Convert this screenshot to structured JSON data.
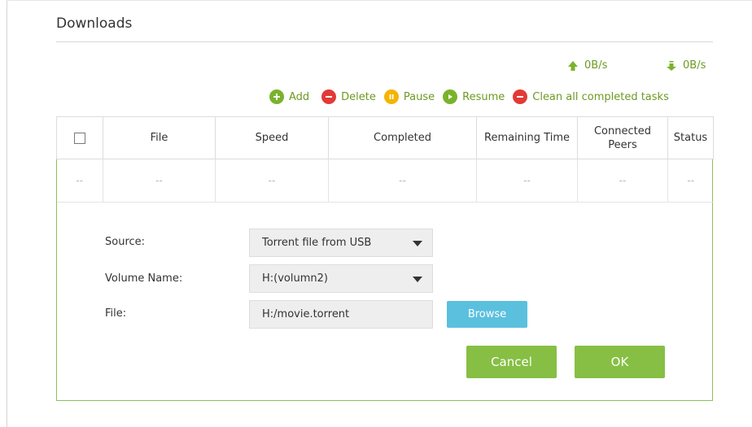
{
  "section": {
    "title": "Downloads"
  },
  "rates": {
    "upload": "0B/s",
    "download": "0B/s"
  },
  "actions": {
    "add": "Add",
    "delete": "Delete",
    "pause": "Pause",
    "resume": "Resume",
    "clean": "Clean all completed tasks"
  },
  "table": {
    "headers": {
      "file": "File",
      "speed": "Speed",
      "completed": "Completed",
      "remaining": "Remaining Time",
      "peers": "Connected Peers",
      "status": "Status"
    },
    "empty_row": [
      "--",
      "--",
      "--",
      "--",
      "--",
      "--",
      "--"
    ]
  },
  "form": {
    "source": {
      "label": "Source:",
      "value": "Torrent file from USB"
    },
    "volume": {
      "label": "Volume Name:",
      "value": "H:(volumn2)"
    },
    "file": {
      "label": "File:",
      "value": "H:/movie.torrent"
    },
    "browse_label": "Browse",
    "cancel_label": "Cancel",
    "ok_label": "OK"
  },
  "colors": {
    "accent_green": "#7ab32b",
    "text_green": "#6e9a22",
    "danger_red": "#e23a36",
    "pause_yellow": "#f4b400",
    "browse_blue": "#5bc0de",
    "panel_border": "#8dc05a"
  },
  "icons": {
    "upload": "arrow-up-icon",
    "download": "arrow-down-icon",
    "add": "plus-circle-icon",
    "delete": "minus-circle-icon",
    "pause": "pause-circle-icon",
    "resume": "play-circle-icon",
    "clean": "minus-circle-icon"
  }
}
